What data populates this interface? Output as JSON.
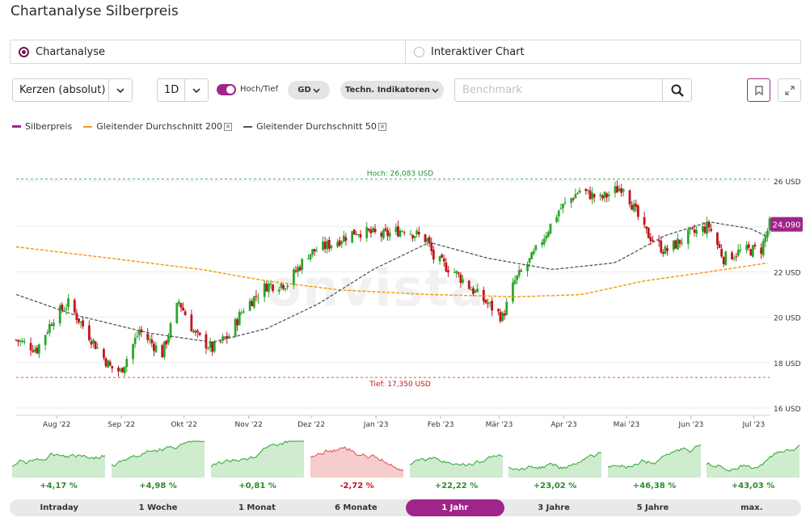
{
  "title": "Chartanalyse Silberpreis",
  "modes": [
    {
      "label": "Chartanalyse",
      "selected": true
    },
    {
      "label": "Interaktiver Chart",
      "selected": false
    }
  ],
  "toolbar": {
    "chart_type": "Kerzen (absolut)",
    "interval": "1D",
    "toggle_label": "Hoch/Tief",
    "toggle_on": true,
    "gd_label": "GD",
    "indicators_label": "Techn. Indikatoren",
    "benchmark_placeholder": "Benchmark"
  },
  "legend": [
    {
      "name": "Silberpreis",
      "color": "#a0258a",
      "style": "solid",
      "removable": false
    },
    {
      "name": "Gleitender Durchschnitt 200",
      "color": "#f39c12",
      "style": "dashed",
      "removable": true
    },
    {
      "name": "Gleitender Durchschnitt 50",
      "color": "#555555",
      "style": "dashed",
      "removable": true
    }
  ],
  "chart_data": {
    "type": "candlestick",
    "x_ticks": [
      "Aug '22",
      "Sep '22",
      "Okt '22",
      "Nov '22",
      "Dez '22",
      "Jan '23",
      "Feb '23",
      "Mär '23",
      "Apr '23",
      "Mai '23",
      "Jun '23",
      "Jul '23"
    ],
    "y_ticks": [
      "16 USD",
      "18 USD",
      "20 USD",
      "22 USD",
      "24 USD",
      "26 USD"
    ],
    "ylim": [
      16,
      26
    ],
    "high_label": "Hoch: 26,083 USD",
    "high_value": 26.083,
    "low_label": "Tief: 17,350 USD",
    "low_value": 17.35,
    "last_price_label": "24,090",
    "last_price": 24.09,
    "colors": {
      "up": "#2ea52e",
      "down": "#c0151b",
      "ma200": "#f39c12",
      "ma50": "#555555",
      "accent": "#a0258a"
    },
    "price_anchors": [
      [
        "2022-07-18",
        19.0
      ],
      [
        "2022-07-28",
        18.6
      ],
      [
        "2022-08-05",
        20.0
      ],
      [
        "2022-08-12",
        20.6
      ],
      [
        "2022-08-22",
        19.2
      ],
      [
        "2022-09-01",
        17.8
      ],
      [
        "2022-09-06",
        17.6
      ],
      [
        "2022-09-15",
        19.4
      ],
      [
        "2022-09-26",
        18.4
      ],
      [
        "2022-10-04",
        20.7
      ],
      [
        "2022-10-12",
        19.2
      ],
      [
        "2022-10-20",
        18.6
      ],
      [
        "2022-10-28",
        19.2
      ],
      [
        "2022-11-04",
        20.4
      ],
      [
        "2022-11-15",
        21.4
      ],
      [
        "2022-11-25",
        21.5
      ],
      [
        "2022-12-05",
        22.8
      ],
      [
        "2022-12-15",
        23.2
      ],
      [
        "2022-12-28",
        23.8
      ],
      [
        "2023-01-10",
        23.6
      ],
      [
        "2023-01-20",
        23.9
      ],
      [
        "2023-01-31",
        23.4
      ],
      [
        "2023-02-03",
        22.6
      ],
      [
        "2023-02-13",
        22.0
      ],
      [
        "2023-02-24",
        21.0
      ],
      [
        "2023-03-08",
        20.0
      ],
      [
        "2023-03-14",
        21.6
      ],
      [
        "2023-03-22",
        22.6
      ],
      [
        "2023-04-04",
        24.7
      ],
      [
        "2023-04-14",
        25.6
      ],
      [
        "2023-04-24",
        25.2
      ],
      [
        "2023-05-05",
        25.8
      ],
      [
        "2023-05-15",
        23.8
      ],
      [
        "2023-05-25",
        22.9
      ],
      [
        "2023-06-05",
        23.6
      ],
      [
        "2023-06-15",
        24.0
      ],
      [
        "2023-06-22",
        22.6
      ],
      [
        "2023-06-30",
        22.9
      ],
      [
        "2023-07-10",
        23.0
      ],
      [
        "2023-07-14",
        24.09
      ]
    ],
    "ma200_anchors": [
      [
        "2022-07-18",
        23.1
      ],
      [
        "2022-09-01",
        22.6
      ],
      [
        "2022-10-15",
        22.1
      ],
      [
        "2022-11-15",
        21.6
      ],
      [
        "2022-12-20",
        21.2
      ],
      [
        "2023-02-01",
        21.0
      ],
      [
        "2023-03-15",
        20.9
      ],
      [
        "2023-04-15",
        21.0
      ],
      [
        "2023-05-15",
        21.6
      ],
      [
        "2023-06-15",
        22.0
      ],
      [
        "2023-07-14",
        22.4
      ]
    ],
    "ma50_anchors": [
      [
        "2022-07-18",
        21.0
      ],
      [
        "2022-08-15",
        20.1
      ],
      [
        "2022-09-20",
        19.3
      ],
      [
        "2022-10-20",
        18.9
      ],
      [
        "2022-11-15",
        19.5
      ],
      [
        "2022-12-10",
        20.6
      ],
      [
        "2023-01-05",
        22.1
      ],
      [
        "2023-02-01",
        23.3
      ],
      [
        "2023-03-01",
        22.6
      ],
      [
        "2023-04-01",
        22.1
      ],
      [
        "2023-05-01",
        22.4
      ],
      [
        "2023-05-25",
        23.6
      ],
      [
        "2023-06-15",
        24.2
      ],
      [
        "2023-07-05",
        23.9
      ],
      [
        "2023-07-14",
        23.5
      ]
    ]
  },
  "mini_charts": [
    {
      "label": "+4,17 %",
      "positive": true
    },
    {
      "label": "+4,98 %",
      "positive": true
    },
    {
      "label": "+0,81 %",
      "positive": true
    },
    {
      "label": "-2,72 %",
      "positive": false
    },
    {
      "label": "+22,22 %",
      "positive": true
    },
    {
      "label": "+23,02 %",
      "positive": true
    },
    {
      "label": "+46,38 %",
      "positive": true
    },
    {
      "label": "+43,03 %",
      "positive": true
    }
  ],
  "periods": [
    {
      "label": "Intraday",
      "active": false
    },
    {
      "label": "1 Woche",
      "active": false
    },
    {
      "label": "1 Monat",
      "active": false
    },
    {
      "label": "6 Monate",
      "active": false
    },
    {
      "label": "1 Jahr",
      "active": true
    },
    {
      "label": "3 Jahre",
      "active": false
    },
    {
      "label": "5 Jahre",
      "active": false
    },
    {
      "label": "max.",
      "active": false
    }
  ]
}
